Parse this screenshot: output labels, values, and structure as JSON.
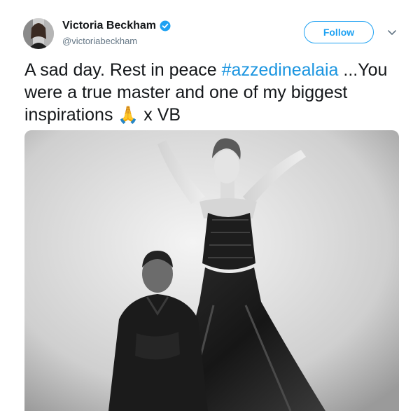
{
  "author": {
    "name": "Victoria Beckham",
    "handle": "@victoriabeckham",
    "verified": true
  },
  "follow_button": {
    "label": "Follow"
  },
  "tweet": {
    "text_before": "A sad day. Rest in peace ",
    "hashtag": "#azzedinealaia",
    "text_after": " ...You were a true master and one of my biggest inspirations ",
    "emoji": "🙏",
    "signoff": " x VB"
  },
  "colors": {
    "accent": "#1da1f2",
    "hashtag": "#1b95e0",
    "handle": "#657786",
    "text": "#14171a"
  },
  "icons": {
    "verified": "verified-badge-icon",
    "caret": "chevron-down-icon"
  }
}
